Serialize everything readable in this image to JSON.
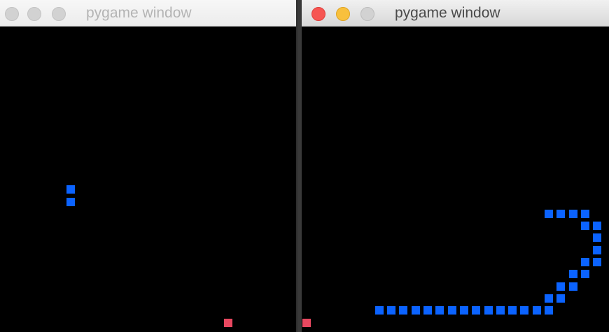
{
  "windows": [
    {
      "id": "left",
      "title": "pygame window",
      "active": false,
      "snake": [
        [
          6,
          14
        ],
        [
          6,
          15
        ]
      ],
      "food": [
        [
          19,
          25
        ]
      ]
    },
    {
      "id": "right",
      "title": "pygame window",
      "active": true,
      "snake": [
        [
          20,
          16
        ],
        [
          21,
          16
        ],
        [
          22,
          16
        ],
        [
          23,
          16
        ],
        [
          23,
          17
        ],
        [
          24,
          17
        ],
        [
          24,
          18
        ],
        [
          24,
          19
        ],
        [
          23,
          20
        ],
        [
          24,
          20
        ],
        [
          22,
          21
        ],
        [
          23,
          21
        ],
        [
          21,
          22
        ],
        [
          22,
          22
        ],
        [
          20,
          23
        ],
        [
          21,
          23
        ],
        [
          6,
          24
        ],
        [
          7,
          24
        ],
        [
          8,
          24
        ],
        [
          9,
          24
        ],
        [
          10,
          24
        ],
        [
          11,
          24
        ],
        [
          12,
          24
        ],
        [
          13,
          24
        ],
        [
          14,
          24
        ],
        [
          15,
          24
        ],
        [
          16,
          24
        ],
        [
          17,
          24
        ],
        [
          18,
          24
        ],
        [
          19,
          24
        ],
        [
          20,
          24
        ]
      ],
      "food": [
        [
          0,
          25
        ]
      ]
    }
  ],
  "colors": {
    "snake": "#0b63ff",
    "food": "#e84860",
    "background": "#000000"
  }
}
